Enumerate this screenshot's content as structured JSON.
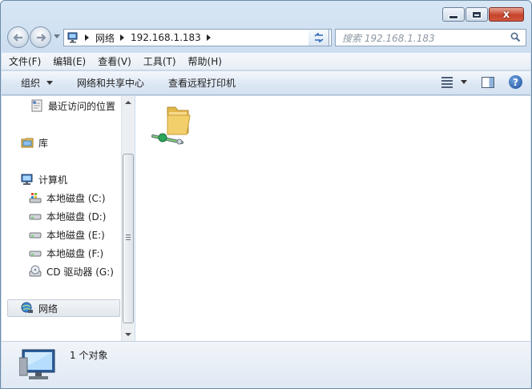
{
  "window": {
    "minimize_icon": "minimize-icon",
    "maximize_icon": "maximize-icon",
    "close_icon": "close-icon",
    "close_glyph": "x"
  },
  "navigation": {
    "breadcrumb": [
      "网络",
      "192.168.1.183"
    ],
    "search_placeholder": "搜索 192.168.1.183"
  },
  "menu": {
    "items": [
      "文件(F)",
      "编辑(E)",
      "查看(V)",
      "工具(T)",
      "帮助(H)"
    ]
  },
  "commands": {
    "organize": "组织",
    "network_center": "网络和共享中心",
    "view_printers": "查看远程打印机",
    "help_glyph": "?"
  },
  "sidebar": {
    "items": [
      {
        "label": "最近访问的位置",
        "icon": "recent-places-icon"
      },
      {
        "label": "库",
        "icon": "library-icon"
      },
      {
        "label": "计算机",
        "icon": "computer-icon"
      },
      {
        "label": "本地磁盘 (C:)",
        "icon": "system-drive-icon"
      },
      {
        "label": "本地磁盘 (D:)",
        "icon": "drive-icon"
      },
      {
        "label": "本地磁盘 (E:)",
        "icon": "drive-icon"
      },
      {
        "label": "本地磁盘 (F:)",
        "icon": "drive-icon"
      },
      {
        "label": "CD 驱动器 (G:)",
        "icon": "cd-drive-icon"
      },
      {
        "label": "网络",
        "icon": "network-icon"
      }
    ]
  },
  "content": {
    "items": [
      {
        "icon": "shared-folder-icon"
      }
    ]
  },
  "details": {
    "count_text": "1 个对象",
    "icon": "network-computer-icon"
  },
  "colors": {
    "accent": "#3b6aa8",
    "window_frame": "#c9dcef",
    "close_button": "#c7432b"
  }
}
